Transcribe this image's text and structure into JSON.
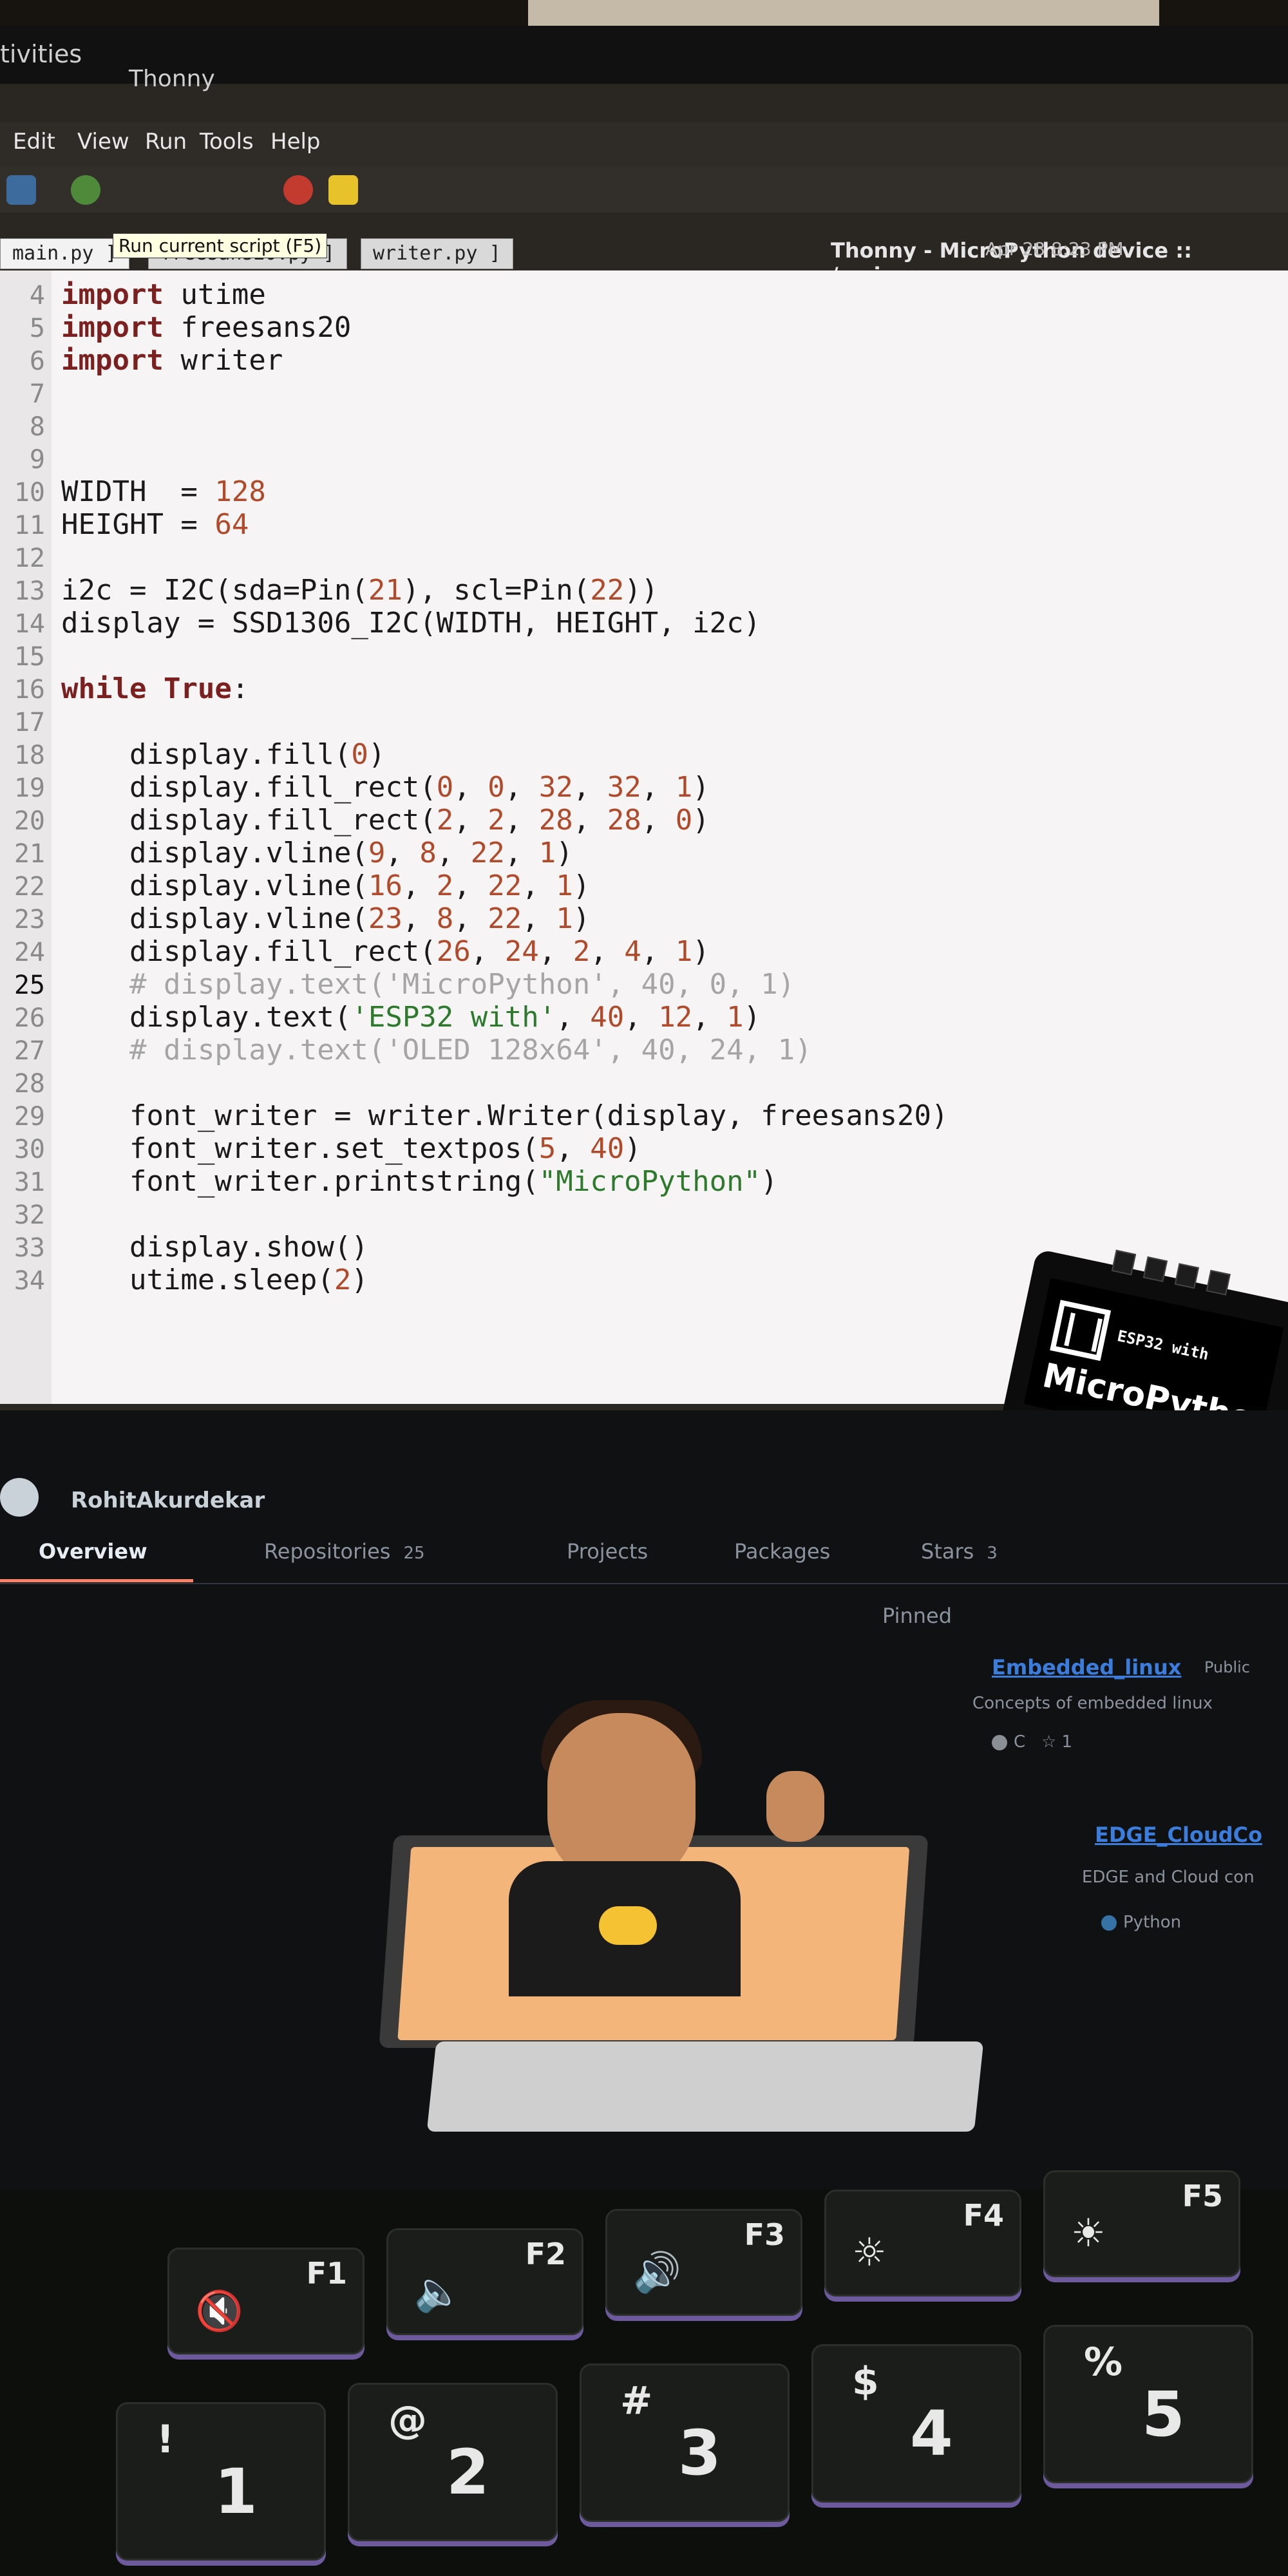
{
  "gnome": {
    "activities": "tivities",
    "app_menu": "Thonny"
  },
  "menubar": [
    "Edit",
    "View",
    "Run",
    "Tools",
    "Help"
  ],
  "window_title": "Thonny - MicroPython device :: /main.py",
  "clock": "Apr 28  8:23 PM",
  "tabs": [
    "main.py",
    "freesans20.py",
    "writer.py"
  ],
  "tooltip": "Run current script (F5)",
  "editor": {
    "current_line": 25,
    "lines": [
      {
        "n": "4",
        "t": "import utime"
      },
      {
        "n": "5",
        "t": "import freesans20"
      },
      {
        "n": "6",
        "t": "import writer"
      },
      {
        "n": "7",
        "t": ""
      },
      {
        "n": "8",
        "t": ""
      },
      {
        "n": "9",
        "t": ""
      },
      {
        "n": "10",
        "t": "WIDTH  = 128"
      },
      {
        "n": "11",
        "t": "HEIGHT = 64"
      },
      {
        "n": "12",
        "t": ""
      },
      {
        "n": "13",
        "t": "i2c = I2C(sda=Pin(21), scl=Pin(22))"
      },
      {
        "n": "14",
        "t": "display = SSD1306_I2C(WIDTH, HEIGHT, i2c)"
      },
      {
        "n": "15",
        "t": ""
      },
      {
        "n": "16",
        "t": "while True:"
      },
      {
        "n": "17",
        "t": ""
      },
      {
        "n": "18",
        "t": "    display.fill(0)"
      },
      {
        "n": "19",
        "t": "    display.fill_rect(0, 0, 32, 32, 1)"
      },
      {
        "n": "20",
        "t": "    display.fill_rect(2, 2, 28, 28, 0)"
      },
      {
        "n": "21",
        "t": "    display.vline(9, 8, 22, 1)"
      },
      {
        "n": "22",
        "t": "    display.vline(16, 2, 22, 1)"
      },
      {
        "n": "23",
        "t": "    display.vline(23, 8, 22, 1)"
      },
      {
        "n": "24",
        "t": "    display.fill_rect(26, 24, 2, 4, 1)"
      },
      {
        "n": "25",
        "t": "    # display.text('MicroPython', 40, 0, 1)"
      },
      {
        "n": "26",
        "t": "    display.text('ESP32 with', 40, 12, 1)"
      },
      {
        "n": "27",
        "t": "    # display.text('OLED 128x64', 40, 24, 1)"
      },
      {
        "n": "28",
        "t": ""
      },
      {
        "n": "29",
        "t": "    font_writer = writer.Writer(display, freesans20)"
      },
      {
        "n": "30",
        "t": "    font_writer.set_textpos(5, 40)"
      },
      {
        "n": "31",
        "t": "    font_writer.printstring(\"MicroPython\")"
      },
      {
        "n": "32",
        "t": ""
      },
      {
        "n": "33",
        "t": "    display.show()"
      },
      {
        "n": "34",
        "t": "    utime.sleep(2)"
      }
    ]
  },
  "oled": {
    "line1": "ESP32 with",
    "line2": "MicroPython"
  },
  "github": {
    "username": "RohitAkurdekar",
    "tabs": [
      {
        "label": "Overview",
        "count": ""
      },
      {
        "label": "Repositories",
        "count": "25"
      },
      {
        "label": "Projects",
        "count": ""
      },
      {
        "label": "Packages",
        "count": ""
      },
      {
        "label": "Stars",
        "count": "3"
      }
    ],
    "pinned_label": "Pinned",
    "repos": [
      {
        "name": "Embedded_linux",
        "badge": "Public",
        "desc": "Concepts of embedded linux",
        "lang": "C",
        "stars": "1",
        "lang_color": "#8a8f96"
      },
      {
        "name": "EDGE_CloudCo",
        "badge": "",
        "desc": "EDGE and Cloud con",
        "lang": "Python",
        "stars": "",
        "lang_color": "#3572A5"
      }
    ]
  },
  "keyboard": {
    "fn_keys": [
      {
        "fn": "F1",
        "glyph": "🔇"
      },
      {
        "fn": "F2",
        "glyph": "🔈"
      },
      {
        "fn": "F3",
        "glyph": "🔊"
      },
      {
        "fn": "F4",
        "glyph": "☼"
      },
      {
        "fn": "F5",
        "glyph": "☀"
      }
    ],
    "num_keys": [
      {
        "main": "1",
        "sub": "!"
      },
      {
        "main": "2",
        "sub": "@"
      },
      {
        "main": "3",
        "sub": "#"
      },
      {
        "main": "4",
        "sub": "$"
      },
      {
        "main": "5",
        "sub": "%"
      }
    ]
  }
}
